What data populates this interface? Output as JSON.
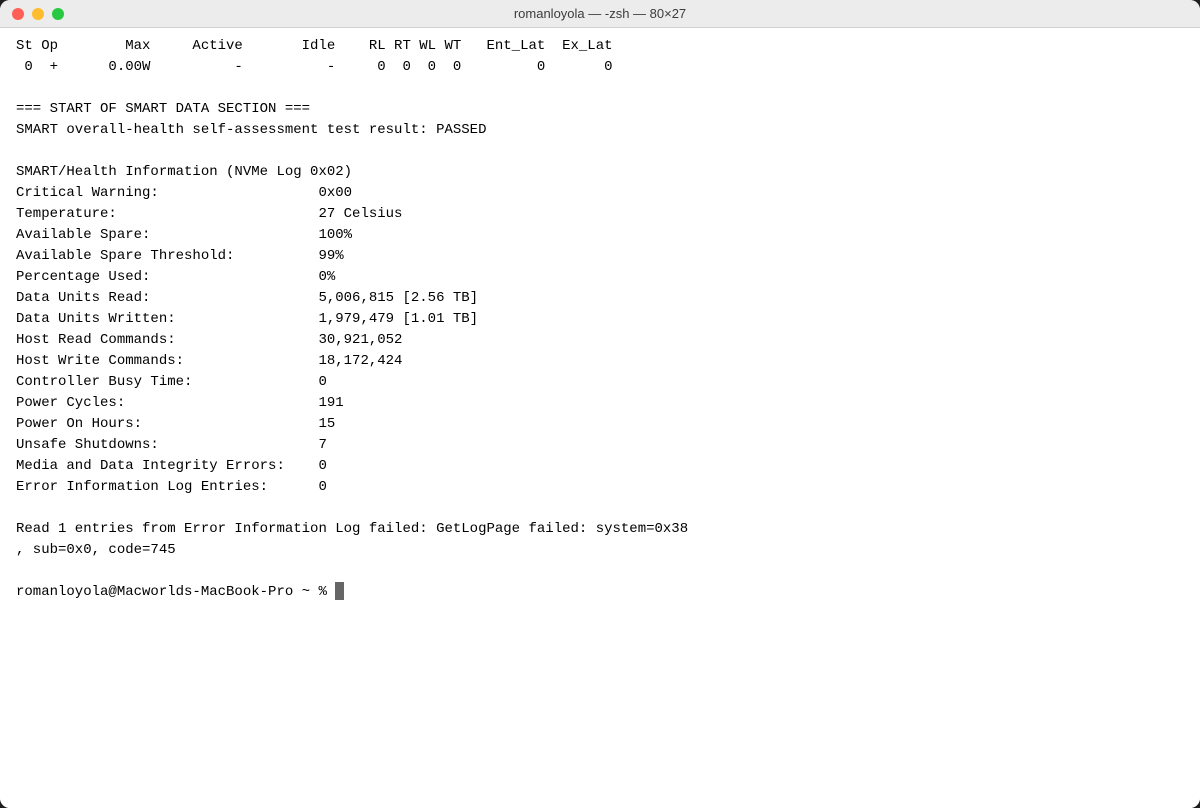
{
  "window": {
    "title": "romanloyola — -zsh — 80×27",
    "buttons": {
      "close": "close",
      "minimize": "minimize",
      "maximize": "maximize"
    }
  },
  "terminal": {
    "lines": [
      "St Op        Max     Active       Idle    RL RT WL WT   Ent_Lat  Ex_Lat",
      " 0  +      0.00W          -          -     0  0  0  0         0       0",
      "",
      "=== START OF SMART DATA SECTION ===",
      "SMART overall-health self-assessment test result: PASSED",
      "",
      "SMART/Health Information (NVMe Log 0x02)",
      "Critical Warning:                   0x00",
      "Temperature:                        27 Celsius",
      "Available Spare:                    100%",
      "Available Spare Threshold:          99%",
      "Percentage Used:                    0%",
      "Data Units Read:                    5,006,815 [2.56 TB]",
      "Data Units Written:                 1,979,479 [1.01 TB]",
      "Host Read Commands:                 30,921,052",
      "Host Write Commands:                18,172,424",
      "Controller Busy Time:               0",
      "Power Cycles:                       191",
      "Power On Hours:                     15",
      "Unsafe Shutdowns:                   7",
      "Media and Data Integrity Errors:    0",
      "Error Information Log Entries:      0",
      "",
      "Read 1 entries from Error Information Log failed: GetLogPage failed: system=0x38",
      ", sub=0x0, code=745",
      "",
      "romanloyola@Macworlds-MacBook-Pro ~ % "
    ],
    "prompt_line_index": 26,
    "has_cursor": true
  }
}
